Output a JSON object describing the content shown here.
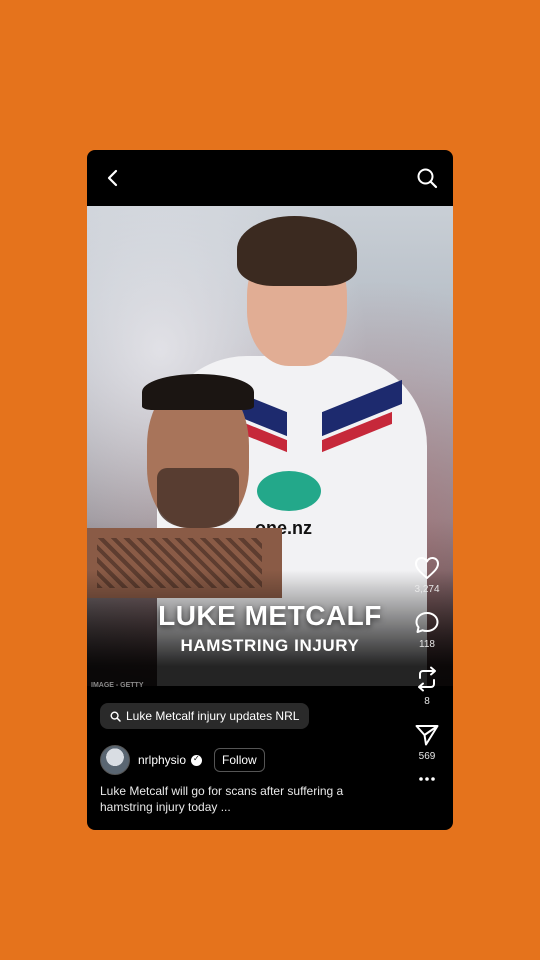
{
  "background_color": "#E5731C",
  "topbar": {
    "back_icon": "chevron-left-icon",
    "search_icon": "search-icon"
  },
  "media": {
    "overlay_title": "LUKE METCALF",
    "overlay_subtitle": "HAMSTRING INJURY",
    "image_credit": "IMAGE - GETTY",
    "jersey_sponsor": "one.nz"
  },
  "actions": {
    "likes": "3,274",
    "comments": "118",
    "reposts": "8",
    "shares": "569"
  },
  "search_chip": {
    "label": "Luke Metcalf injury updates NRL"
  },
  "author": {
    "username": "nrlphysio",
    "follow_label": "Follow"
  },
  "caption": "Luke Metcalf will go for scans after suffering a hamstring injury today ..."
}
